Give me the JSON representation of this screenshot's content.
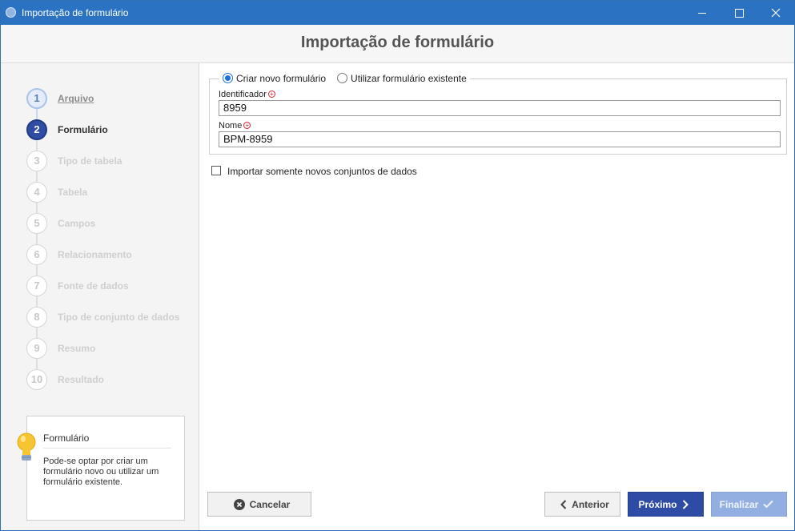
{
  "window": {
    "title": "Importação de formulário"
  },
  "header": {
    "title": "Importação de formulário"
  },
  "steps": [
    {
      "num": "1",
      "label": "Arquivo",
      "state": "visited"
    },
    {
      "num": "2",
      "label": "Formulário",
      "state": "active"
    },
    {
      "num": "3",
      "label": "Tipo de tabela",
      "state": "disabled"
    },
    {
      "num": "4",
      "label": "Tabela",
      "state": "disabled"
    },
    {
      "num": "5",
      "label": "Campos",
      "state": "disabled"
    },
    {
      "num": "6",
      "label": "Relacionamento",
      "state": "disabled"
    },
    {
      "num": "7",
      "label": "Fonte de dados",
      "state": "disabled"
    },
    {
      "num": "8",
      "label": "Tipo de conjunto de dados",
      "state": "disabled"
    },
    {
      "num": "9",
      "label": "Resumo",
      "state": "disabled"
    },
    {
      "num": "10",
      "label": "Resultado",
      "state": "disabled"
    }
  ],
  "help": {
    "title": "Formulário",
    "text": "Pode-se optar por criar um formulário novo ou utilizar um formulário existente."
  },
  "form": {
    "radio_new": {
      "label": "Criar novo formulário",
      "checked": true
    },
    "radio_existing": {
      "label": "Utilizar formulário existente",
      "checked": false
    },
    "identifier": {
      "label": "Identificador",
      "value": "8959"
    },
    "name": {
      "label": "Nome",
      "value": "BPM-8959"
    },
    "import_only_new": {
      "label": "Importar somente novos conjuntos de dados",
      "checked": false
    }
  },
  "buttons": {
    "cancel": "Cancelar",
    "previous": "Anterior",
    "next": "Próximo",
    "finish": "Finalizar"
  },
  "colors": {
    "titlebar": "#2b72c2",
    "primary": "#2e4ba6",
    "disabled_primary": "#93aee0",
    "required": "#dd2233"
  }
}
